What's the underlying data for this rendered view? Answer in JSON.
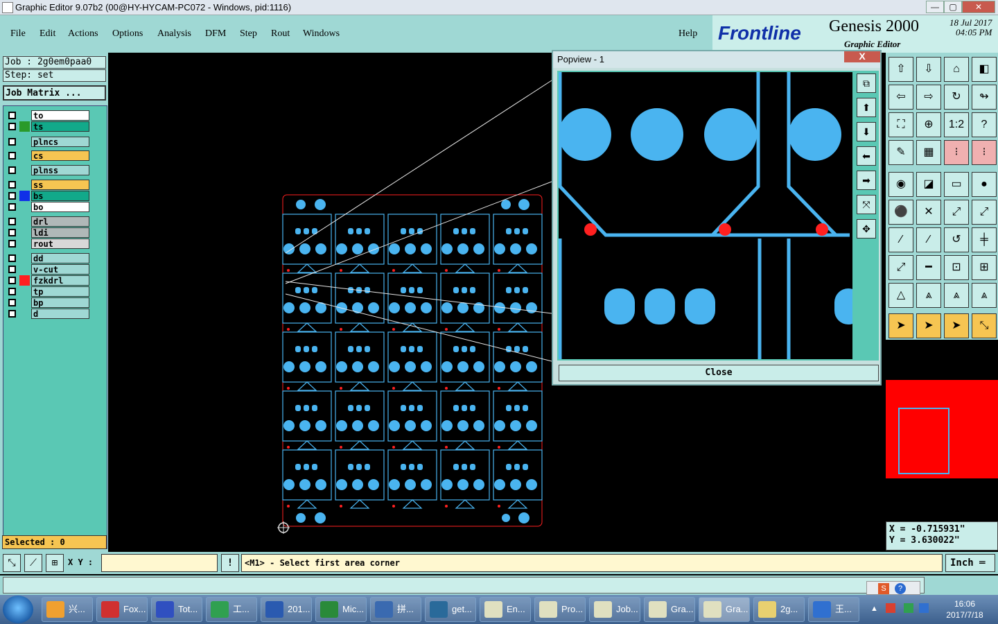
{
  "window": {
    "title": "Graphic Editor 9.07b2 (00@HY-HYCAM-PC072 - Windows, pid:1116)",
    "min": "—",
    "max": "▢",
    "close": "✕"
  },
  "menu": [
    "File",
    "Edit",
    "Actions",
    "Options",
    "Analysis",
    "DFM",
    "Step",
    "Rout",
    "Windows"
  ],
  "help": "Help",
  "brand": {
    "logo": "Frontline",
    "product": "Genesis 2000",
    "subtitle": "Graphic Editor",
    "date": "18 Jul 2017",
    "time": "04:05 PM"
  },
  "job": {
    "job_label": "Job : 2g0em0paa0",
    "step_label": "Step: set",
    "matrix_button": "Job Matrix ..."
  },
  "layers": [
    {
      "name": "to",
      "bg": "#ffffff",
      "color": ""
    },
    {
      "name": "ts",
      "bg": "#12a98a",
      "color": "#2a9a2a"
    },
    {
      "name": "plncs",
      "bg": "#9fd8d4",
      "color": ""
    },
    {
      "name": "cs",
      "bg": "#f6c552",
      "color": ""
    },
    {
      "name": "plnss",
      "bg": "#9fd8d4",
      "color": ""
    },
    {
      "name": "ss",
      "bg": "#f6c552",
      "color": ""
    },
    {
      "name": "bs",
      "bg": "#12a98a",
      "color": "#1030e8"
    },
    {
      "name": "bo",
      "bg": "#ffffff",
      "color": ""
    },
    {
      "name": "drl",
      "bg": "#b0b8b8",
      "color": ""
    },
    {
      "name": "ldi",
      "bg": "#b0b8b8",
      "color": ""
    },
    {
      "name": "rout",
      "bg": "#d8d8d8",
      "color": ""
    },
    {
      "name": "dd",
      "bg": "#9fd8d4",
      "color": ""
    },
    {
      "name": "v-cut",
      "bg": "#9fd8d4",
      "color": ""
    },
    {
      "name": "fzkdrl",
      "bg": "#9fd8d4",
      "color": "#ff2020"
    },
    {
      "name": "tp",
      "bg": "#9fd8d4",
      "color": ""
    },
    {
      "name": "bp",
      "bg": "#9fd8d4",
      "color": ""
    },
    {
      "name": "d",
      "bg": "#9fd8d4",
      "color": ""
    }
  ],
  "selected_label": "Selected : 0",
  "popview": {
    "title": "Popview - 1",
    "close_x": "X",
    "close_button": "Close"
  },
  "coords": {
    "x": "X = -0.715931\"",
    "y": "Y = 3.630022\""
  },
  "status": {
    "xy_label": "X Y :",
    "prompt": "<M1> - Select first area corner",
    "unit": "Inch ═"
  },
  "taskbar": {
    "items": [
      "兴...",
      "Fox...",
      "Tot...",
      "工...",
      "201...",
      "Mic...",
      "拼...",
      "get...",
      "En...",
      "Pro...",
      "Job...",
      "Gra...",
      "Gra...",
      "2g...",
      "王..."
    ],
    "clock_time": "16:06",
    "clock_date": "2017/7/18"
  },
  "colors": {
    "teal_bg": "#9fd8d4",
    "pad_blue": "#4ab4f0",
    "outline_red": "#ff2020"
  }
}
